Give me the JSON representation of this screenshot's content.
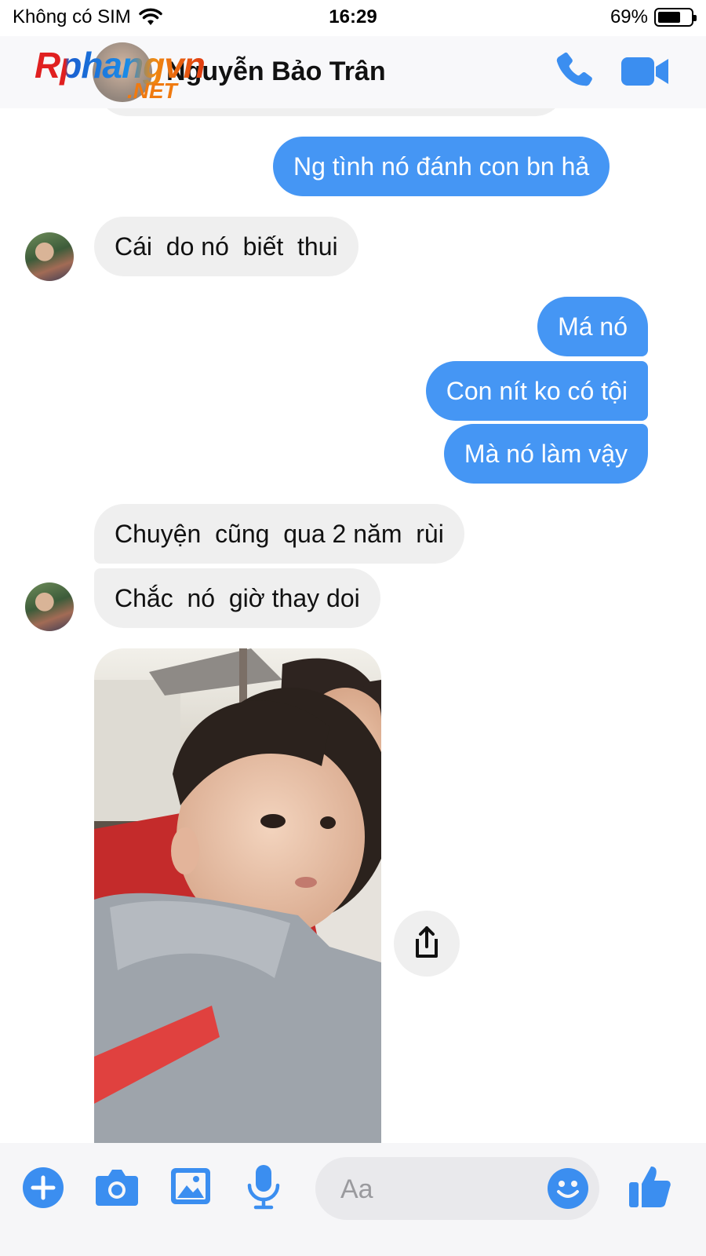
{
  "status_bar": {
    "carrier": "Không có SIM",
    "time": "16:29",
    "battery_percent": "69%",
    "battery_level": 0.69
  },
  "header": {
    "contact_name": "Nguyễn Bảo Trân",
    "watermark_main": "Rphangvn",
    "watermark_sub": ".NET",
    "accent_color": "#4596f4"
  },
  "messages": [
    {
      "direction": "outgoing",
      "text": "Ng tình nó đánh con bn hả"
    },
    {
      "direction": "incoming",
      "text": "Cái  do nó  biết  thui"
    },
    {
      "direction": "outgoing",
      "text": "Má nó"
    },
    {
      "direction": "outgoing",
      "text": "Con nít ko có tội"
    },
    {
      "direction": "outgoing",
      "text": "Mà nó làm vậy"
    },
    {
      "direction": "incoming",
      "text": "Chuyện  cũng  qua 2 năm  rùi"
    },
    {
      "direction": "incoming",
      "text": "Chắc  nó  giờ thay doi"
    },
    {
      "direction": "incoming",
      "type": "photo",
      "icon": "photo-child"
    }
  ],
  "composer": {
    "placeholder": "Aa",
    "icons": [
      "plus-icon",
      "camera-icon",
      "gallery-icon",
      "microphone-icon",
      "emoji-icon",
      "thumbs-up-icon"
    ]
  },
  "colors": {
    "outgoing_bubble": "#4596f4",
    "incoming_bubble": "#efefef",
    "icon_blue": "#3b8ef0"
  }
}
